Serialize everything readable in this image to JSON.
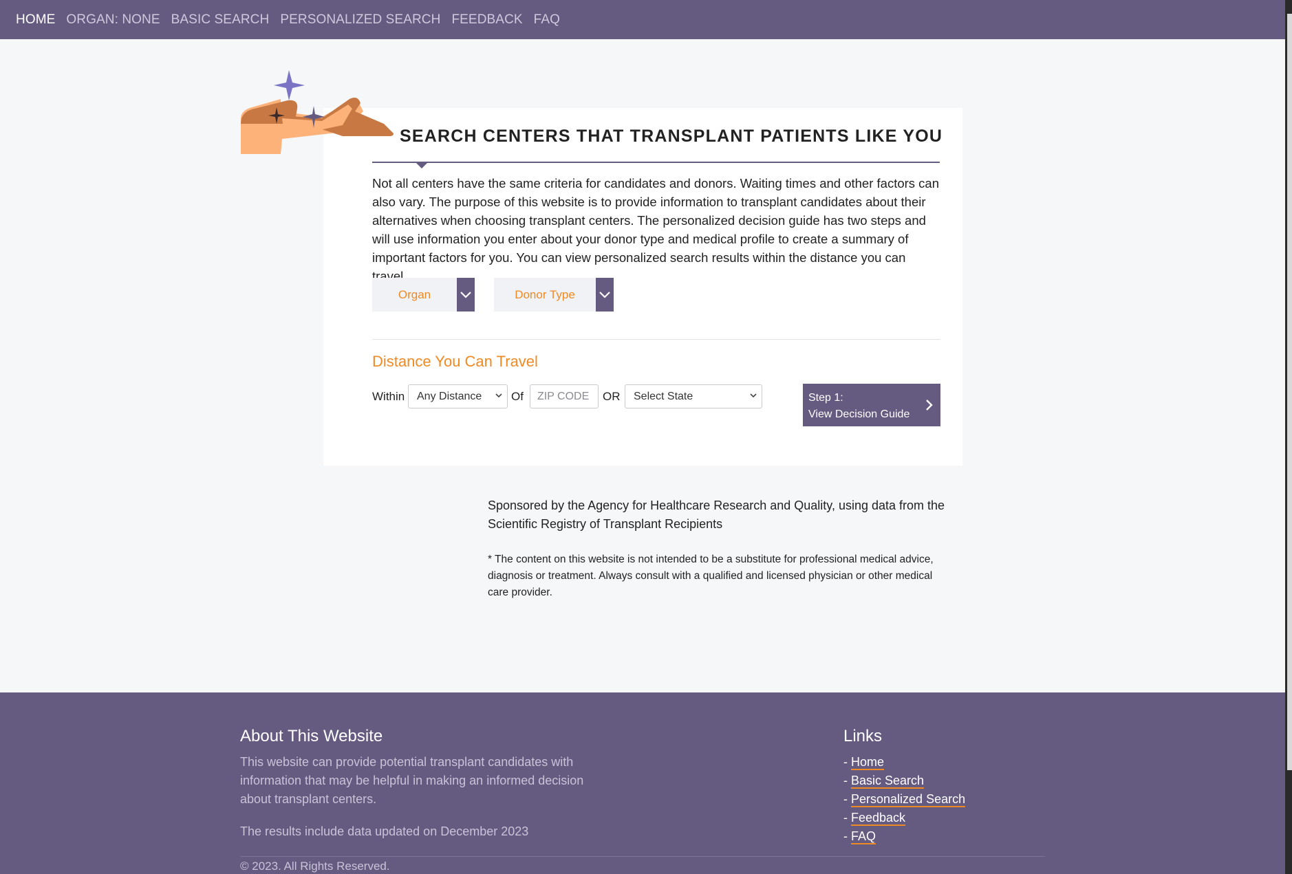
{
  "nav": {
    "items": [
      {
        "label": "HOME"
      },
      {
        "label": "ORGAN: NONE"
      },
      {
        "label": "BASIC SEARCH"
      },
      {
        "label": "PERSONALIZED SEARCH"
      },
      {
        "label": "FEEDBACK"
      },
      {
        "label": "FAQ"
      }
    ]
  },
  "main": {
    "title": "SEARCH CENTERS THAT TRANSPLANT PATIENTS LIKE YOU",
    "intro": "Not all centers have the same criteria for candidates and donors. Waiting times and other factors can also vary. The purpose of this website is to provide information to transplant candidates about their alternatives when choosing transplant centers. The personalized decision guide has two steps and will use information you enter about your donor type and medical profile to create a summary of important factors for you. You can view personalized search results within the distance you can travel.",
    "organ_dropdown": "Organ",
    "donor_dropdown": "Donor Type",
    "distance_title": "Distance You Can Travel",
    "within_label": "Within",
    "distance_value": "Any Distance",
    "of_label": "Of",
    "zip_placeholder": "ZIP CODE",
    "or_label": "OR",
    "state_value": "Select State",
    "step_line1": "Step 1:",
    "step_line2": "View Decision Guide"
  },
  "sponsor": "Sponsored by the Agency for Healthcare Research and Quality, using data from the Scientific Registry of Transplant Recipients",
  "disclaimer": "* The content on this website is not intended to be a substitute for professional medical advice, diagnosis or treatment. Always consult with a qualified and licensed physician or other medical care provider.",
  "footer": {
    "about_title": "About This Website",
    "about_text": "This website can provide potential transplant candidates with information that may be helpful in making an informed decision about transplant centers.",
    "updated": "The results include data updated on December 2023",
    "copyright": "© 2023. All Rights Reserved.",
    "links_title": "Links",
    "links": [
      {
        "label": "Home"
      },
      {
        "label": "Basic Search"
      },
      {
        "label": "Personalized Search"
      },
      {
        "label": "Feedback"
      },
      {
        "label": "FAQ"
      }
    ]
  },
  "colors": {
    "brand_purple": "#655a80",
    "accent_orange": "#f08a24",
    "star_lavender": "#7b73c4"
  },
  "icons": [
    "chevron-down-icon",
    "chevron-right-icon",
    "hand-illustration",
    "star-icon"
  ]
}
